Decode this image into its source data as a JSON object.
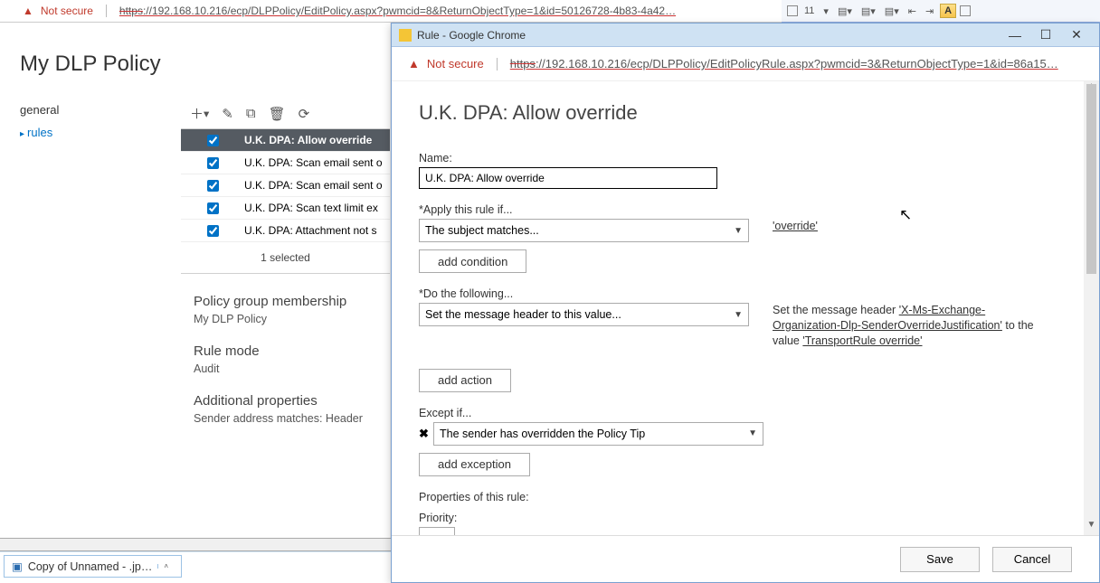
{
  "back_window": {
    "not_secure": "Not secure",
    "url_strike": "https",
    "url_rest": "://192.168.10.216/ecp/DLPPolicy/EditPolicy.aspx?pwmcid=8&ReturnObjectType=1&id=50126728-4b83-4a42…",
    "page_title": "My DLP Policy",
    "nav": {
      "general": "general",
      "rules": "rules"
    },
    "rules": [
      {
        "name": "U.K. DPA: Allow override",
        "checked": true,
        "selected": true
      },
      {
        "name": "U.K. DPA: Scan email sent o",
        "checked": true,
        "selected": false
      },
      {
        "name": "U.K. DPA: Scan email sent o",
        "checked": true,
        "selected": false
      },
      {
        "name": "U.K. DPA: Scan text limit ex",
        "checked": true,
        "selected": false
      },
      {
        "name": "U.K. DPA: Attachment not s",
        "checked": true,
        "selected": false
      }
    ],
    "selected_count": "1 selected",
    "details": {
      "pgm_h": "Policy group membership",
      "pgm_v": "My DLP Policy",
      "mode_h": "Rule mode",
      "mode_v": "Audit",
      "add_h": "Additional properties",
      "add_v": "Sender address matches: Header"
    }
  },
  "taskbar": {
    "item": "Copy of Unnamed - .jp…"
  },
  "ribbon": {
    "size": "11"
  },
  "modal": {
    "title": "Rule - Google Chrome",
    "not_secure": "Not secure",
    "url_strike": "https",
    "url_rest": "://192.168.10.216/ecp/DLPPolicy/EditPolicyRule.aspx?pwmcid=3&ReturnObjectType=1&id=86a15…",
    "heading": "U.K. DPA: Allow override",
    "name_label": "Name:",
    "name_value": "U.K. DPA: Allow override",
    "apply_label": "Apply this rule if...",
    "condition_value": "The subject matches...",
    "condition_side": "'override'",
    "add_condition": "add condition",
    "do_label": "Do the following...",
    "action_value": "Set the message header to this value...",
    "action_side_pre": "Set the message header ",
    "action_side_link1": "'X-Ms-Exchange-Organization-Dlp-SenderOverrideJustification'",
    "action_side_mid": " to the value ",
    "action_side_link2": "'TransportRule override'",
    "add_action": "add action",
    "except_label": "Except if...",
    "except_value": "The sender has overridden the Policy Tip",
    "add_exception": "add exception",
    "props_label": "Properties of this rule:",
    "priority_label": "Priority:",
    "save": "Save",
    "cancel": "Cancel"
  }
}
